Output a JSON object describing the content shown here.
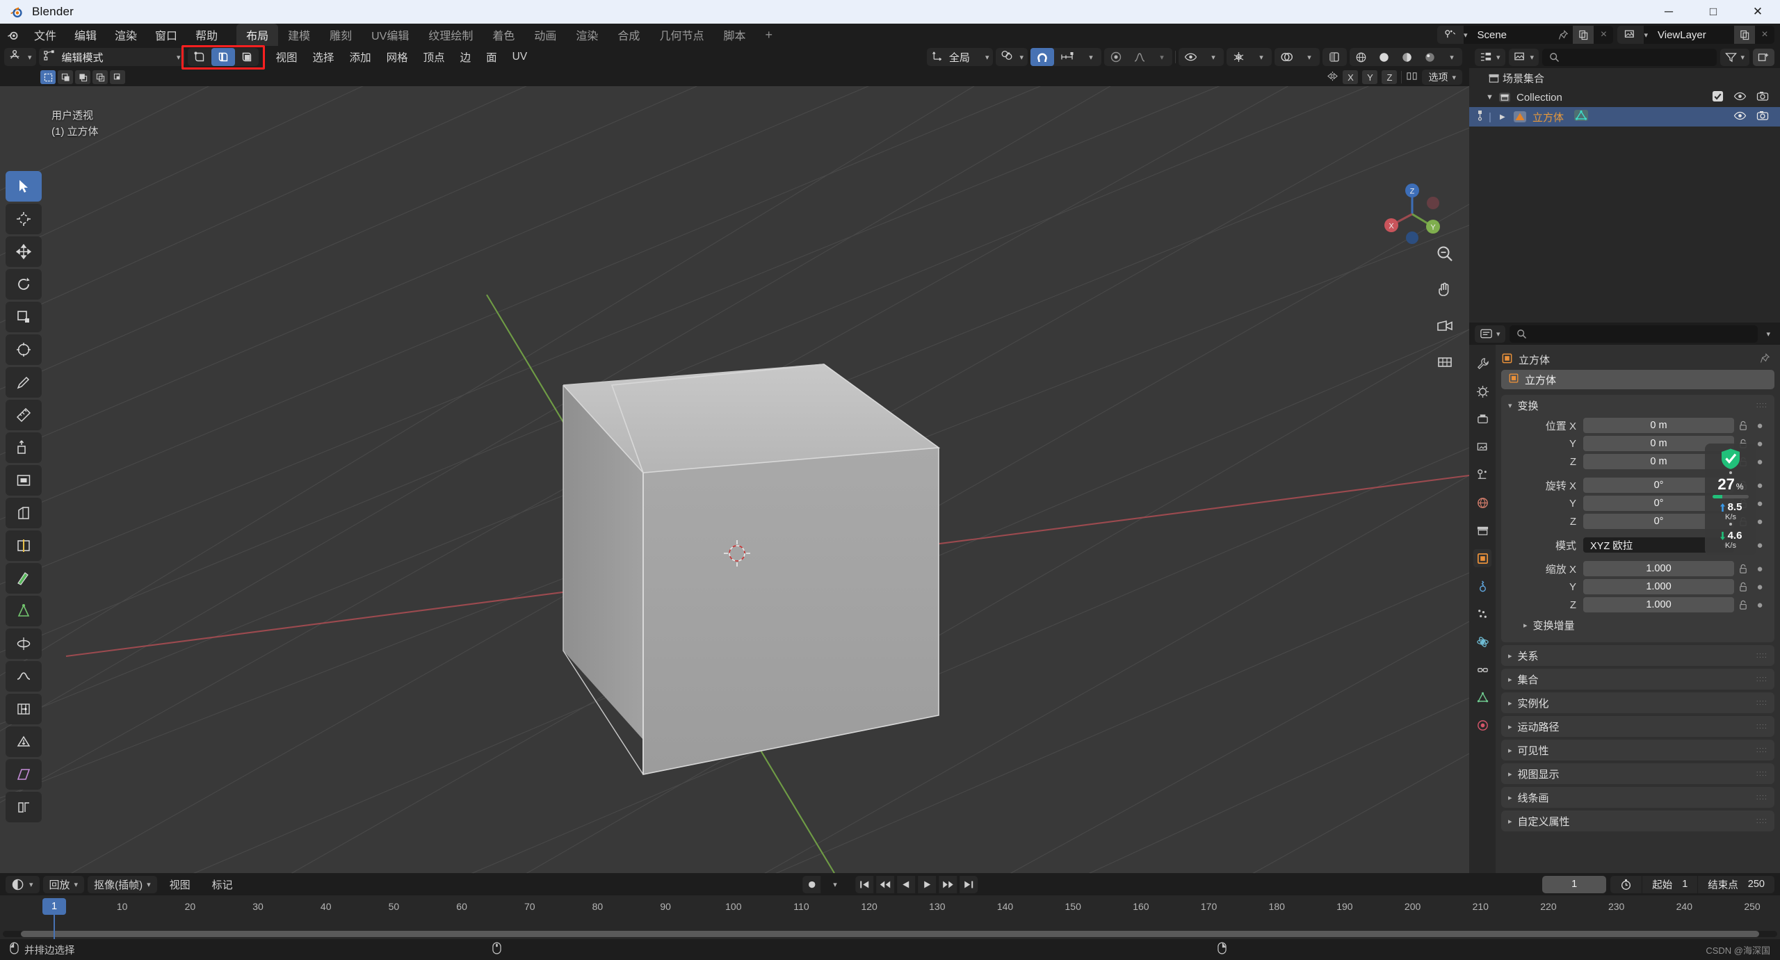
{
  "window": {
    "title": "Blender",
    "minimize": "─",
    "maximize": "□",
    "close": "✕"
  },
  "topbar": {
    "menus": [
      "文件",
      "编辑",
      "渲染",
      "窗口",
      "帮助"
    ],
    "workspace_tabs": [
      {
        "label": "布局",
        "active": true
      },
      {
        "label": "建模",
        "active": false
      },
      {
        "label": "雕刻",
        "active": false
      },
      {
        "label": "UV编辑",
        "active": false
      },
      {
        "label": "纹理绘制",
        "active": false
      },
      {
        "label": "着色",
        "active": false
      },
      {
        "label": "动画",
        "active": false
      },
      {
        "label": "渲染",
        "active": false
      },
      {
        "label": "合成",
        "active": false
      },
      {
        "label": "几何节点",
        "active": false
      },
      {
        "label": "脚本",
        "active": false
      }
    ],
    "add_workspace": "+",
    "scene": {
      "icon": "scene-icon",
      "name": "Scene",
      "pin": "pin-icon",
      "copy": "copy-icon",
      "close": "×"
    },
    "viewlayer": {
      "icon": "viewlayer-icon",
      "name": "ViewLayer",
      "copy": "copy-icon",
      "close": "×"
    }
  },
  "viewport": {
    "mode": "编辑模式",
    "select_modes": [
      {
        "name": "vertex-select-mode",
        "active": false
      },
      {
        "name": "edge-select-mode",
        "active": true
      },
      {
        "name": "face-select-mode",
        "active": false
      }
    ],
    "menus": [
      "视图",
      "选择",
      "添加",
      "网格",
      "顶点",
      "边",
      "面",
      "UV"
    ],
    "transform_orientation": "全局",
    "snap_on": true,
    "proportional_on": false,
    "overlay_text_line1": "用户透视",
    "overlay_text_line2": "(1) 立方体",
    "axis_labels": [
      "X",
      "Y",
      "Z"
    ],
    "select_dropdown": "选项",
    "gizmo_labels": {
      "x": "X",
      "y": "Y",
      "z": "Z"
    },
    "tools": [
      "tweak-select-tool",
      "cursor-tool",
      "move-tool",
      "rotate-tool",
      "scale-tool",
      "transform-tool",
      "annotate-tool",
      "measure-tool",
      "extrude-region-tool",
      "inset-faces-tool",
      "bevel-tool",
      "loop-cut-tool",
      "knife-tool",
      "poly-build-tool",
      "spin-tool",
      "smooth-tool",
      "edge-slide-tool",
      "shrink-fatten-tool",
      "shear-tool",
      "rip-region-tool"
    ],
    "highlight_box": "select-mode-group-highlight"
  },
  "outliner": {
    "display_mode_icon": "outliner-display-icon",
    "filter_icon": "filter-icon",
    "new_collection_icon": "new-collection-icon",
    "search_placeholder": "",
    "rows": [
      {
        "label": "场景集合",
        "icon": "collection-icon",
        "indent": 0,
        "selected": false,
        "checkbox": false,
        "eye": false,
        "camera": false,
        "expand": ""
      },
      {
        "label": "Collection",
        "icon": "collection-icon",
        "indent": 1,
        "selected": false,
        "checkbox": true,
        "eye": true,
        "camera": true,
        "expand": "▼"
      },
      {
        "label": "立方体",
        "icon": "mesh-object-icon",
        "indent": 2,
        "selected": true,
        "checkbox": false,
        "eye": true,
        "camera": true,
        "expand": "▶"
      }
    ]
  },
  "properties": {
    "breadcrumb_object": "立方体",
    "name_field": "立方体",
    "tabs": [
      "tool-tab",
      "render-tab",
      "output-tab",
      "view-layer-tab",
      "scene-tab",
      "world-tab",
      "collection-tab",
      "object-tab",
      "modifier-tab",
      "particles-tab",
      "physics-tab",
      "constraint-tab",
      "data-tab",
      "material-tab"
    ],
    "active_tab_index": 7,
    "transform_panel": {
      "title": "变换",
      "location_label": "位置",
      "rotation_label": "旋转",
      "scale_label": "缩放",
      "mode_label": "模式",
      "axes": [
        "X",
        "Y",
        "Z"
      ],
      "location": [
        "0 m",
        "0 m",
        "0 m"
      ],
      "rotation": [
        "0°",
        "0°",
        "0°"
      ],
      "rotation_mode": "XYZ 欧拉",
      "scale": [
        "1.000",
        "1.000",
        "1.000"
      ]
    },
    "sub_panel": "变换增量",
    "collapsed_panels": [
      "关系",
      "集合",
      "实例化",
      "运动路径",
      "可见性",
      "视图显示",
      "线条画",
      "自定义属性"
    ]
  },
  "timeline": {
    "editor_icon": "timeline-editor-icon",
    "menus": [
      "回放",
      "抠像(插帧)",
      "视图",
      "标记"
    ],
    "playback_buttons": [
      "jump-start",
      "prev-keyframe",
      "play-reverse",
      "play",
      "next-keyframe",
      "jump-end"
    ],
    "record_button": "record-button",
    "current_frame": "1",
    "start_label": "起始",
    "start_value": "1",
    "end_label": "结束点",
    "end_value": "250",
    "ruler_ticks": [
      "1",
      "10",
      "20",
      "30",
      "40",
      "50",
      "60",
      "70",
      "80",
      "90",
      "100",
      "110",
      "120",
      "130",
      "140",
      "150",
      "160",
      "170",
      "180",
      "190",
      "200",
      "210",
      "220",
      "230",
      "240",
      "250"
    ],
    "playhead_frame": "1"
  },
  "statusbar": {
    "left_action": "并排边选择",
    "mouse_icons": [
      "left-mouse-icon",
      "middle-mouse-icon",
      "right-mouse-icon"
    ],
    "watermark": "CSDN @海深国"
  },
  "overlay_widget": {
    "shield_icon": "shield-check-icon",
    "percent": "27",
    "percent_unit": "%",
    "progress": 27,
    "upload_speed": "8.5",
    "upload_unit": "K/s",
    "download_speed": "4.6",
    "download_unit": "K/s"
  },
  "colors": {
    "accent_blue": "#4772b3",
    "highlight_red": "#ff2020",
    "header_dark": "#1d1d1d",
    "panel_bg": "#303030",
    "viewport_bg": "#393939",
    "shield_green": "#21c07a",
    "outliner_select": "#3e5680",
    "mesh_orange": "#e2832b"
  }
}
